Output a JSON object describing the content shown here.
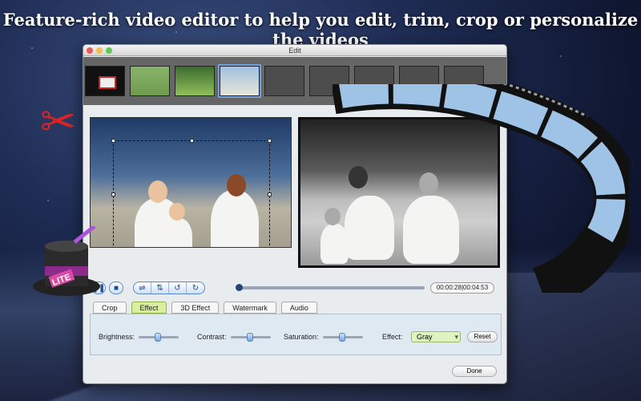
{
  "headline": "Feature-rich video editor to help you edit, trim, crop or personalize the videos",
  "window": {
    "title": "Edit"
  },
  "player": {
    "play_icon": "play-icon",
    "stop_icon": "stop-icon",
    "position": 0.0,
    "time": "00:00:28|00:04:53"
  },
  "tabs": [
    "Crop",
    "Effect",
    "3D Effect",
    "Watermark",
    "Audio"
  ],
  "active_tab": "Effect",
  "effect_panel": {
    "brightness_label": "Brightness:",
    "contrast_label": "Contrast:",
    "saturation_label": "Saturation:",
    "effect_label": "Effect:",
    "effect_value": "Gray",
    "reset_label": "Reset"
  },
  "done_label": "Done",
  "badge": "LITE",
  "colors": {
    "accent": "#5b87c7",
    "active_tab": "#d7ef9f",
    "select": "#dff3c0"
  }
}
